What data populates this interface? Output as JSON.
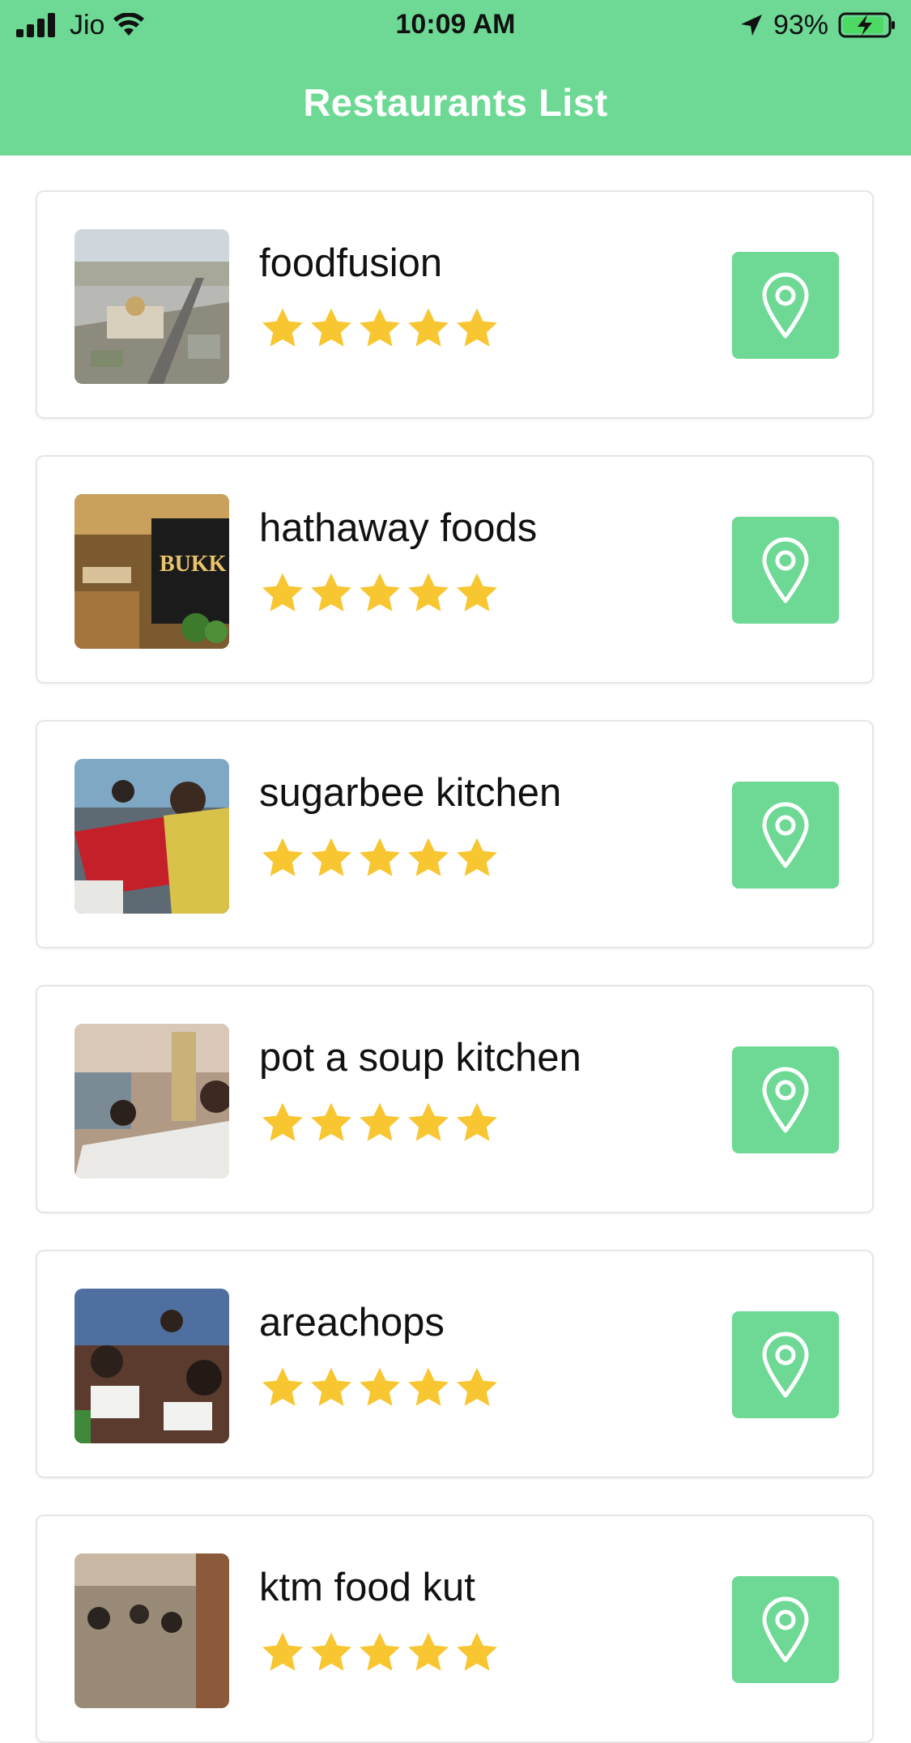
{
  "status_bar": {
    "carrier": "Jio",
    "time": "10:09 AM",
    "battery": "93%"
  },
  "header": {
    "title": "Restaurants List"
  },
  "colors": {
    "accent": "#6dd995",
    "star": "#f7c631"
  },
  "restaurants": [
    {
      "name": "foodfusion",
      "rating": 5
    },
    {
      "name": "hathaway foods",
      "rating": 5
    },
    {
      "name": "sugarbee kitchen",
      "rating": 5
    },
    {
      "name": "pot a soup kitchen",
      "rating": 5
    },
    {
      "name": "areachops",
      "rating": 5
    },
    {
      "name": "ktm food kut",
      "rating": 5
    }
  ]
}
